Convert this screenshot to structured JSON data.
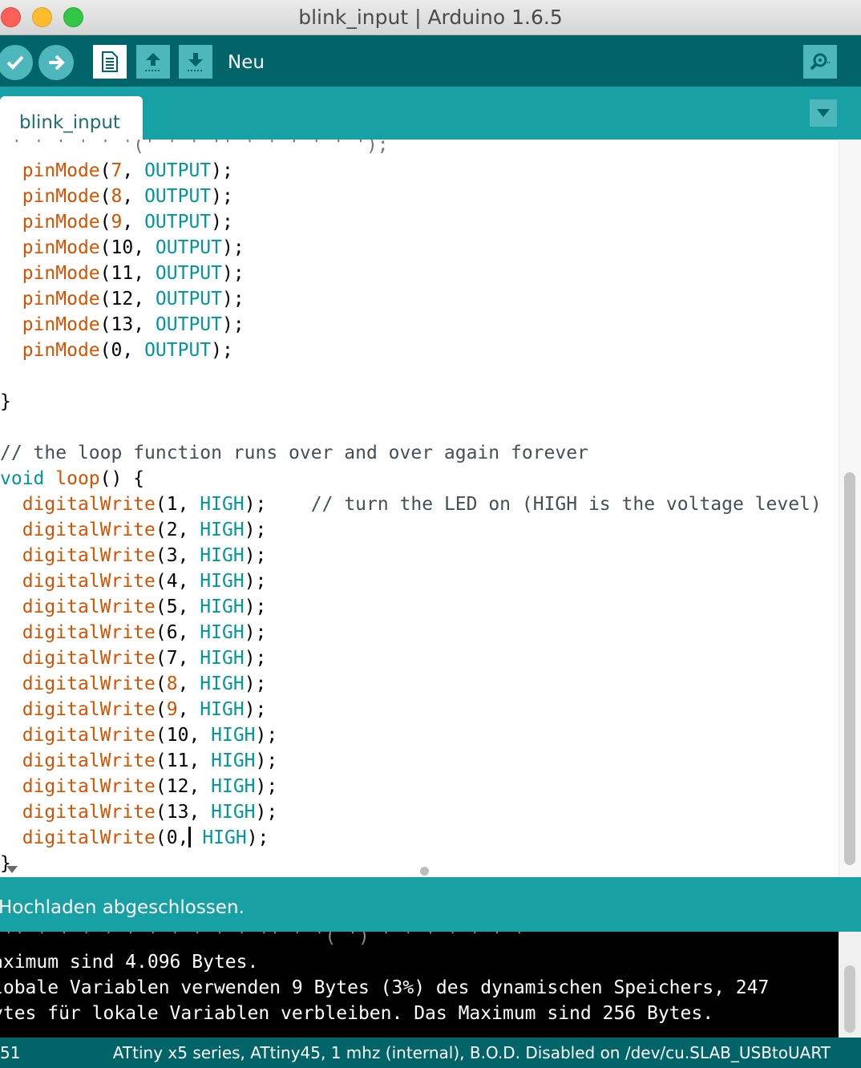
{
  "window": {
    "title": "blink_input | Arduino 1.6.5",
    "traffic_lights": {
      "close": "#fc5f57",
      "minimize": "#fdbc2e",
      "zoom": "#33c748"
    }
  },
  "toolbar": {
    "verify_icon": "check-icon",
    "upload_icon": "arrow-right-icon",
    "new_icon": "document-icon",
    "open_icon": "arrow-up-icon",
    "save_icon": "arrow-down-icon",
    "hover_label": "Neu",
    "serial_monitor_icon": "magnifier-icon"
  },
  "tabs": [
    {
      "label": "blink_input",
      "active": true
    }
  ],
  "editor": {
    "setup_lines": [
      {
        "fn": "pinMode",
        "pre": "(",
        "num": "7",
        "post": ", ",
        "arg": "OUTPUT",
        "end": ");"
      },
      {
        "fn": "pinMode",
        "pre": "(",
        "num": "8",
        "post": ", ",
        "arg": "OUTPUT",
        "end": ");"
      },
      {
        "fn": "pinMode",
        "pre": "(",
        "num": "9",
        "post": ", ",
        "arg": "OUTPUT",
        "end": ");"
      },
      {
        "fn": "pinMode",
        "pre": "(",
        "num": "10",
        "post": ", ",
        "arg": "OUTPUT",
        "end": ");"
      },
      {
        "fn": "pinMode",
        "pre": "(",
        "num": "11",
        "post": ", ",
        "arg": "OUTPUT",
        "end": ");"
      },
      {
        "fn": "pinMode",
        "pre": "(",
        "num": "12",
        "post": ", ",
        "arg": "OUTPUT",
        "end": ");"
      },
      {
        "fn": "pinMode",
        "pre": "(",
        "num": "13",
        "post": ", ",
        "arg": "OUTPUT",
        "end": ");"
      },
      {
        "fn": "pinMode",
        "pre": "(",
        "num": "0",
        "post": ", ",
        "arg": "OUTPUT",
        "end": ");"
      }
    ],
    "close_brace": "}",
    "loop_comment": "// the loop function runs over and over again forever",
    "loop_type": "void",
    "loop_name": "loop",
    "loop_open": "() {",
    "loop_lines": [
      {
        "fn": "digitalWrite",
        "pre": "(",
        "num": "1",
        "post": ", ",
        "arg": "HIGH",
        "end": ");",
        "comment": "    // turn the LED on (HIGH is the voltage level)"
      },
      {
        "fn": "digitalWrite",
        "pre": "(",
        "num": "2",
        "post": ", ",
        "arg": "HIGH",
        "end": ");",
        "comment": ""
      },
      {
        "fn": "digitalWrite",
        "pre": "(",
        "num": "3",
        "post": ", ",
        "arg": "HIGH",
        "end": ");",
        "comment": ""
      },
      {
        "fn": "digitalWrite",
        "pre": "(",
        "num": "4",
        "post": ", ",
        "arg": "HIGH",
        "end": ");",
        "comment": ""
      },
      {
        "fn": "digitalWrite",
        "pre": "(",
        "num": "5",
        "post": ", ",
        "arg": "HIGH",
        "end": ");",
        "comment": ""
      },
      {
        "fn": "digitalWrite",
        "pre": "(",
        "num": "6",
        "post": ", ",
        "arg": "HIGH",
        "end": ");",
        "comment": ""
      },
      {
        "fn": "digitalWrite",
        "pre": "(",
        "num": "7",
        "post": ", ",
        "arg": "HIGH",
        "end": ");",
        "comment": ""
      },
      {
        "fn": "digitalWrite",
        "pre": "(",
        "num": "8",
        "post": ", ",
        "arg": "HIGH",
        "end": ");",
        "comment": ""
      },
      {
        "fn": "digitalWrite",
        "pre": "(",
        "num": "9",
        "post": ", ",
        "arg": "HIGH",
        "end": ");",
        "comment": ""
      },
      {
        "fn": "digitalWrite",
        "pre": "(",
        "num": "10",
        "post": ", ",
        "arg": "HIGH",
        "end": ");",
        "comment": ""
      },
      {
        "fn": "digitalWrite",
        "pre": "(",
        "num": "11",
        "post": ", ",
        "arg": "HIGH",
        "end": ");",
        "comment": ""
      },
      {
        "fn": "digitalWrite",
        "pre": "(",
        "num": "12",
        "post": ", ",
        "arg": "HIGH",
        "end": ");",
        "comment": ""
      },
      {
        "fn": "digitalWrite",
        "pre": "(",
        "num": "13",
        "post": ", ",
        "arg": "HIGH",
        "end": ");",
        "comment": ""
      }
    ],
    "last_line": {
      "fn": "digitalWrite",
      "pre": "(",
      "num": "0",
      "post": ",",
      "post2": " ",
      "arg": "HIGH",
      "end": ");"
    },
    "loop_close": "}"
  },
  "status": {
    "message": "Hochladen abgeschlossen."
  },
  "console": {
    "lines": [
      "aximum sind 4.096 Bytes.",
      "lobale Variablen verwenden 9 Bytes (3%) des dynamischen Speichers, 247",
      "ytes für lokale Variablen verbleiben. Das Maximum sind 256 Bytes."
    ]
  },
  "footer": {
    "line_number": "51",
    "board_info": "ATtiny x5 series, ATtiny45, 1 mhz (internal), B.O.D. Disabled on /dev/cu.SLAB_USBtoUART"
  },
  "colors": {
    "toolbar_bg": "#006468",
    "tabbar_bg": "#17a1a5",
    "button_bg": "#4db7bb",
    "function_color": "#d35400",
    "keyword_color": "#00979c"
  }
}
